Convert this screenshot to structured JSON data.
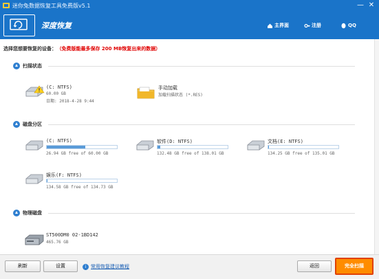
{
  "window": {
    "title": "迷你兔数据恢复工具免费版v5.1",
    "minimize_glyph": "—",
    "close_glyph": "✕"
  },
  "header": {
    "brand": "深度恢复",
    "nav": [
      {
        "label": "主界面",
        "icon": "home-icon"
      },
      {
        "label": "注册",
        "icon": "key-icon"
      },
      {
        "label": "QQ",
        "icon": "qq-icon"
      }
    ]
  },
  "hint": {
    "label": "选择您想要恢复的设备：",
    "warning": "（免费版能最多保存 200 MB恢复出来的数据）"
  },
  "sections": {
    "scan_status": "扫描状态",
    "partitions": "磁盘分区",
    "physical": "物理磁盘"
  },
  "scan_status": [
    {
      "name": "(C: NTFS)",
      "line2": "60.00 GB",
      "line3": "日期: 2018-4-28 9:44",
      "icon": "drive-icon"
    },
    {
      "name": "手动加载",
      "line2": "加载扫描状态 (*.RES)",
      "icon": "folder-icon"
    }
  ],
  "partitions": [
    {
      "name": "(C: NTFS)",
      "sub": "26.94 GB free of 60.00 GB",
      "used_fraction": 0.55
    },
    {
      "name": "软件(D: NTFS)",
      "sub": "132.48 GB free of 138.01 GB",
      "used_fraction": 0.04
    },
    {
      "name": "文档(E: NTFS)",
      "sub": "134.25 GB free of 135.01 GB",
      "used_fraction": 0.01
    },
    {
      "name": "娱乐(F: NTFS)",
      "sub": "134.58 GB free of 134.73 GB",
      "used_fraction": 0.01
    }
  ],
  "physical": [
    {
      "name": "ST500DM0 02-1BD142",
      "sub": "465.76 GB"
    }
  ],
  "footer": {
    "refresh": "刷新",
    "settings": "设置",
    "link": "常用恢复建议教程",
    "back": "返回",
    "full_scan": "完全扫描"
  },
  "colors": {
    "accent": "#1a74c9",
    "warning": "#e00000",
    "primary_button": "#ff8c00"
  }
}
